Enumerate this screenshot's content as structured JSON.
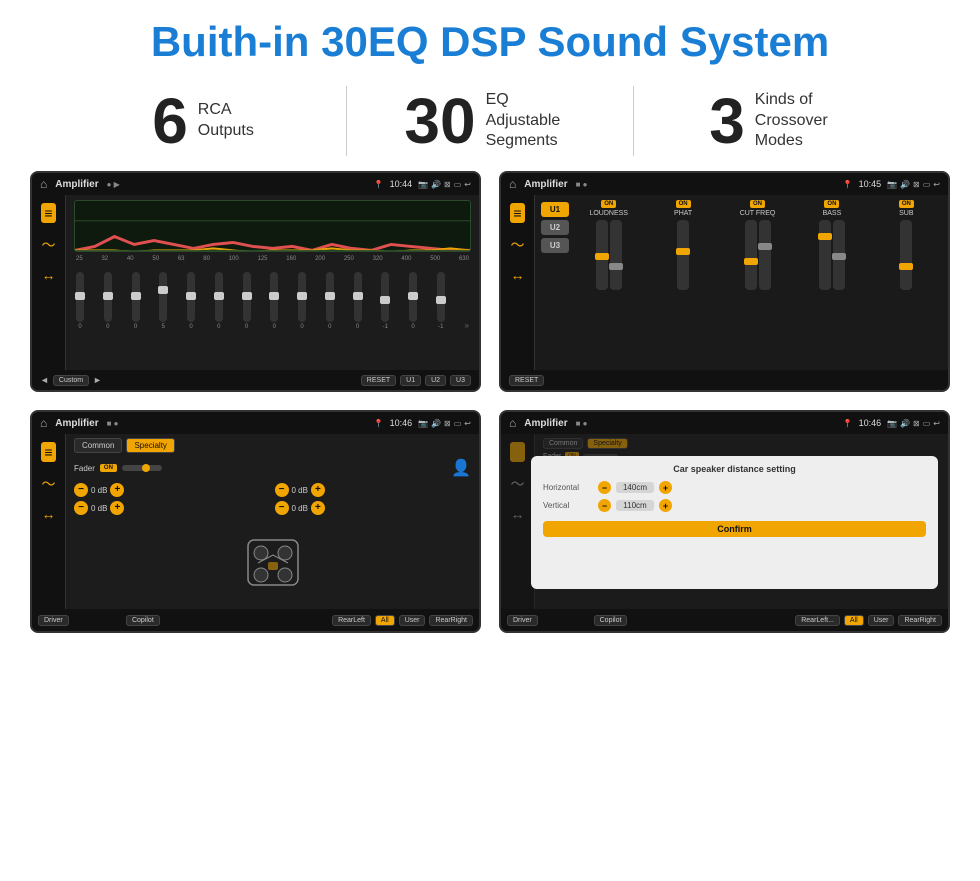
{
  "page": {
    "title": "Buith-in 30EQ DSP Sound System",
    "stats": [
      {
        "number": "6",
        "label": "RCA\nOutputs"
      },
      {
        "number": "30",
        "label": "EQ Adjustable\nSegments"
      },
      {
        "number": "3",
        "label": "Kinds of\nCrossover Modes"
      }
    ]
  },
  "screens": {
    "eq": {
      "title": "Amplifier",
      "time": "10:44",
      "freq_labels": [
        "25",
        "32",
        "40",
        "50",
        "63",
        "80",
        "100",
        "125",
        "160",
        "200",
        "250",
        "320",
        "400",
        "500",
        "630"
      ],
      "slider_values": [
        "0",
        "0",
        "0",
        "5",
        "0",
        "0",
        "0",
        "0",
        "0",
        "0",
        "0",
        "-1",
        "0",
        "-1"
      ],
      "bottom_buttons": [
        "◄",
        "Custom",
        "►",
        "RESET",
        "U1",
        "U2",
        "U3"
      ]
    },
    "dsp": {
      "title": "Amplifier",
      "time": "10:45",
      "u_buttons": [
        "U1",
        "U2",
        "U3"
      ],
      "controls": [
        "LOUDNESS",
        "PHAT",
        "CUT FREQ",
        "BASS",
        "SUB"
      ],
      "reset_label": "RESET"
    },
    "cross": {
      "title": "Amplifier",
      "time": "10:46",
      "tabs": [
        "Common",
        "Specialty"
      ],
      "fader_label": "Fader",
      "fader_on": "ON",
      "db_values": [
        "0 dB",
        "0 dB",
        "0 dB",
        "0 dB"
      ],
      "bottom_buttons": [
        "Driver",
        "",
        "Copilot",
        "RearLeft",
        "All",
        "User",
        "RearRight"
      ]
    },
    "dialog": {
      "title": "Amplifier",
      "time": "10:46",
      "dialog_title": "Car speaker distance setting",
      "horizontal_label": "Horizontal",
      "horizontal_value": "140cm",
      "vertical_label": "Vertical",
      "vertical_value": "110cm",
      "confirm_label": "Confirm",
      "bottom_buttons": [
        "Driver",
        "Copilot",
        "RearLeft",
        "All",
        "User",
        "RearRight"
      ]
    }
  }
}
